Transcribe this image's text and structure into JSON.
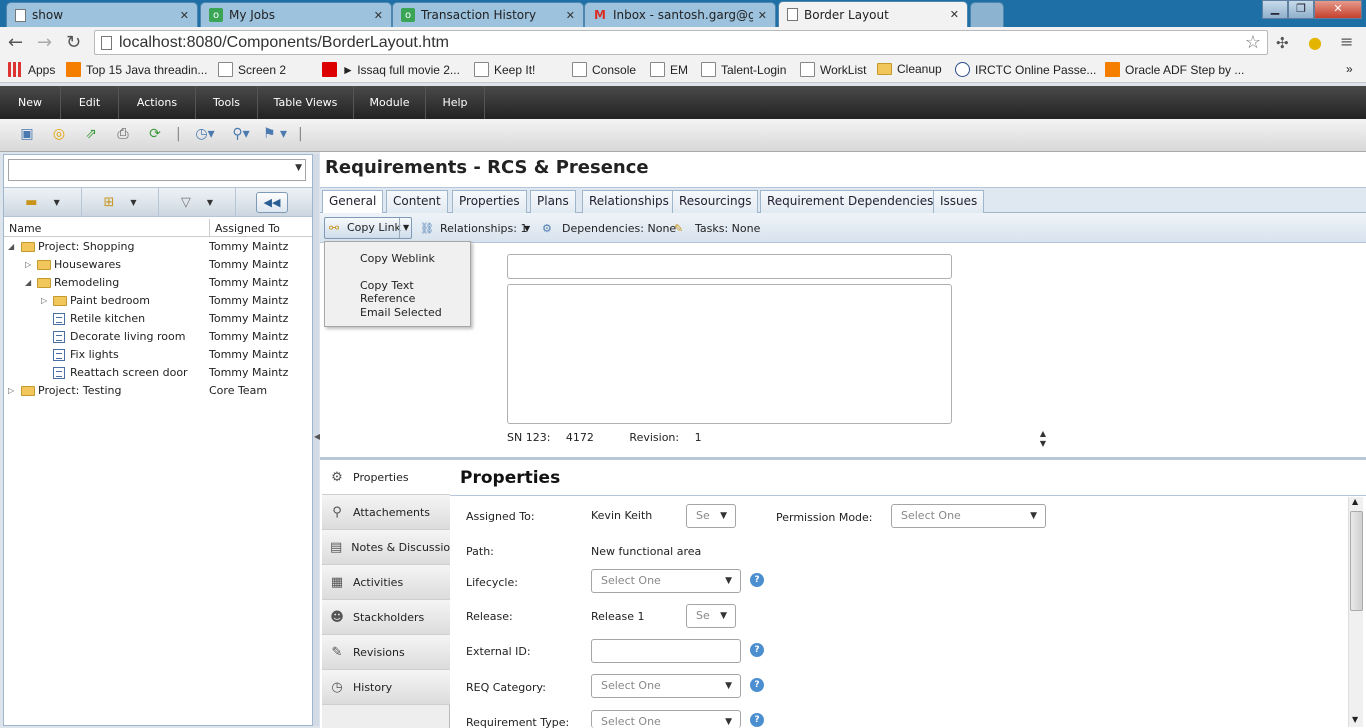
{
  "browser": {
    "tabs": [
      {
        "title": "show",
        "icon": "document-icon"
      },
      {
        "title": "My Jobs",
        "icon": "green-favicon"
      },
      {
        "title": "Transaction History",
        "icon": "green-favicon"
      },
      {
        "title": "Inbox - santosh.garg@gte",
        "icon": "gmail-icon"
      },
      {
        "title": "Border Layout",
        "icon": "document-icon"
      }
    ],
    "url": "localhost:8080/Components/BorderLayout.htm",
    "bookmarks": [
      "Apps",
      "Top 15 Java threadin...",
      "Screen 2",
      "► Issaq full movie 2...",
      "Keep It!",
      "Console",
      "EM",
      "Talent-Login",
      "WorkList",
      "Cleanup",
      "IRCTC Online Passe...",
      "Oracle ADF Step by ..."
    ],
    "more": "»"
  },
  "menu": [
    "New",
    "Edit",
    "Actions",
    "Tools",
    "Table Views",
    "Module",
    "Help"
  ],
  "tree": {
    "col_name": "Name",
    "col_assigned": "Assigned To",
    "rows": [
      {
        "name": "Project: Shopping",
        "owner": "Tommy Maintz"
      },
      {
        "name": "Housewares",
        "owner": "Tommy Maintz"
      },
      {
        "name": "Remodeling",
        "owner": "Tommy Maintz"
      },
      {
        "name": "Paint bedroom",
        "owner": "Tommy Maintz"
      },
      {
        "name": "Retile kitchen",
        "owner": "Tommy Maintz"
      },
      {
        "name": "Decorate living room",
        "owner": "Tommy Maintz"
      },
      {
        "name": "Fix lights",
        "owner": "Tommy Maintz"
      },
      {
        "name": "Reattach screen door",
        "owner": "Tommy Maintz"
      },
      {
        "name": "Project: Testing",
        "owner": "Core Team"
      }
    ]
  },
  "main": {
    "title": "Requirements - RCS & Presence",
    "tabs": [
      "General",
      "Content",
      "Properties",
      "Plans",
      "Relationships",
      "Resourcings",
      "Requirement Dependencies",
      "Issues"
    ],
    "copy_link": "Copy Link",
    "relationships": "Relationships: 1",
    "dependencies": "Dependencies: None",
    "tasks": "Tasks: None",
    "dropdown": [
      "Copy Weblink",
      "Copy Text Reference",
      "Email Selected"
    ],
    "sn_label": "SN 123:",
    "sn_value": "4172",
    "rev_label": "Revision:",
    "rev_value": "1"
  },
  "sidenav": [
    "Properties",
    "Attachements",
    "Notes & Discussions",
    "Activities",
    "Stackholders",
    "Revisions",
    "History"
  ],
  "properties": {
    "title": "Properties",
    "assigned_label": "Assigned To:",
    "assigned_value": "Kevin Keith",
    "small_select": "Se",
    "permission_label": "Permission Mode:",
    "select_one": "Select One",
    "path_label": "Path:",
    "path_value": "New functional area",
    "lifecycle_label": "Lifecycle:",
    "release_label": "Release:",
    "release_value": "Release 1",
    "external_label": "External ID:",
    "category_label": "REQ Category:",
    "reqtype_label": "Requirement Type:"
  }
}
